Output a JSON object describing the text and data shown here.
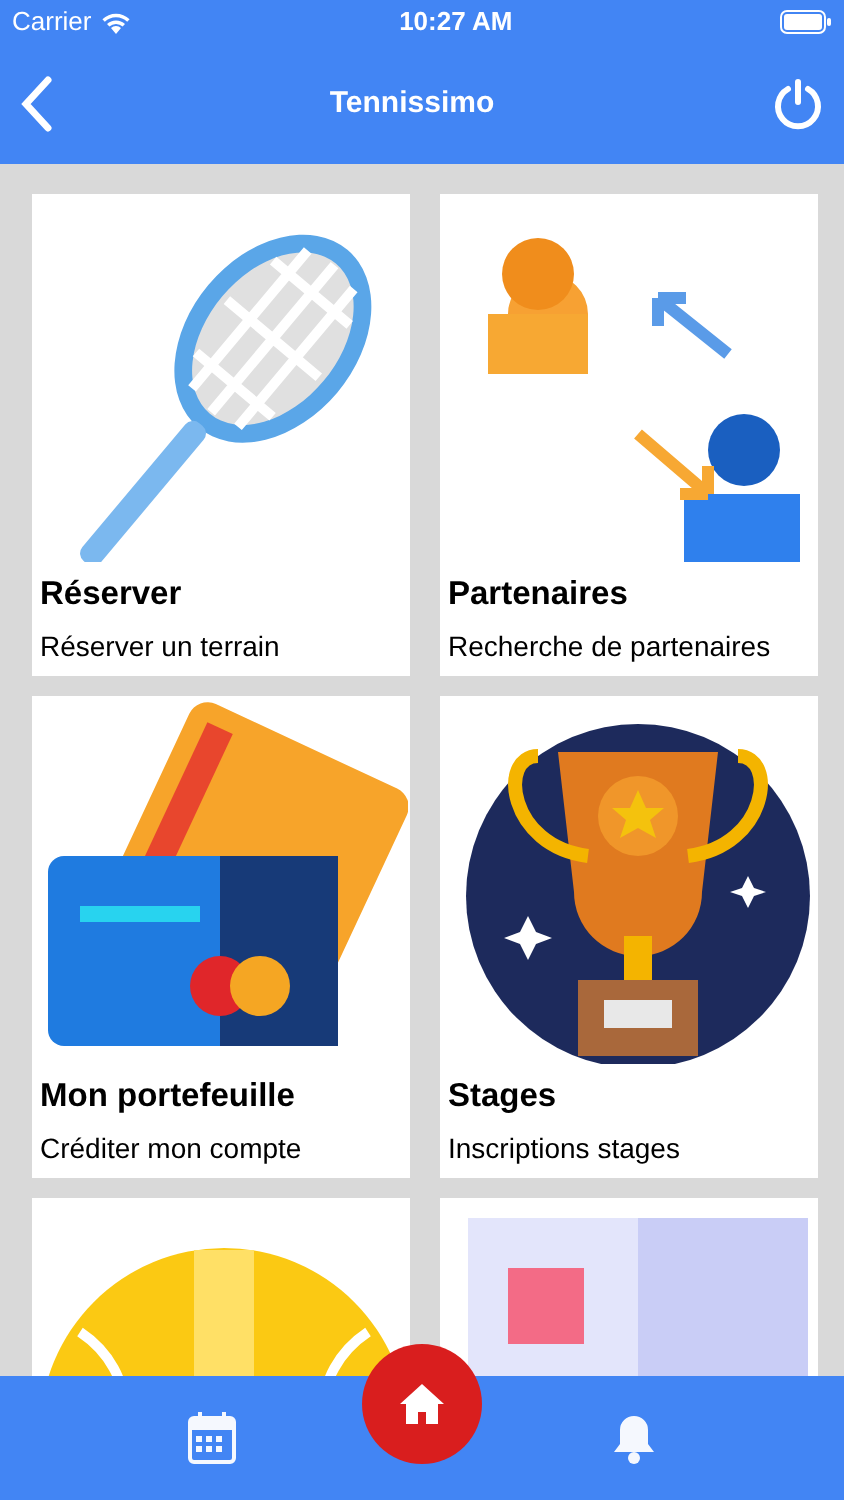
{
  "status_bar": {
    "carrier": "Carrier",
    "time": "10:27 AM"
  },
  "header": {
    "title": "Tennissimo"
  },
  "tiles": [
    {
      "kind": "racket",
      "title": "Réserver",
      "subtitle": "Réserver un terrain"
    },
    {
      "kind": "partners",
      "title": "Partenaires",
      "subtitle": "Recherche de partenaires"
    },
    {
      "kind": "wallet",
      "title": "Mon portefeuille",
      "subtitle": "Créditer mon compte"
    },
    {
      "kind": "trophy",
      "title": "Stages",
      "subtitle": "Inscriptions stages"
    },
    {
      "kind": "ball"
    },
    {
      "kind": "frame"
    }
  ],
  "bottom_nav": [
    {
      "kind": "calendar",
      "selected": false
    },
    {
      "kind": "home",
      "selected": true
    },
    {
      "kind": "bell",
      "selected": false
    }
  ]
}
